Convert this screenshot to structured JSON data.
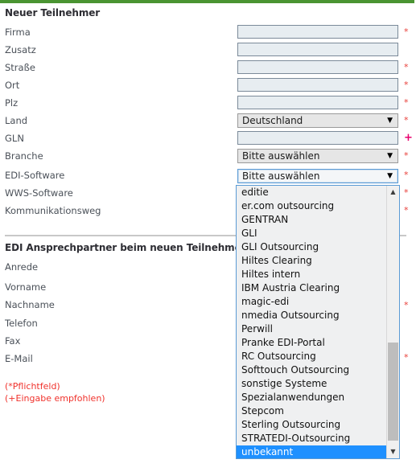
{
  "theme": {
    "accent_green": "#4a9432",
    "required_red": "#e8403a",
    "recommended_pink": "#e8006e",
    "legend_red": "#f0322c",
    "focus_blue": "#5b9bd5",
    "selection_blue": "#1e90ff",
    "input_fill": "#e7edf1",
    "select_fill": "#e6e6e6"
  },
  "sections": {
    "participant": {
      "title": "Neuer Teilnehmer",
      "fields": [
        {
          "label": "Firma",
          "type": "text",
          "value": "",
          "marker": "*"
        },
        {
          "label": "Zusatz",
          "type": "text",
          "value": "",
          "marker": ""
        },
        {
          "label": "Straße",
          "type": "text",
          "value": "",
          "marker": "*"
        },
        {
          "label": "Ort",
          "type": "text",
          "value": "",
          "marker": "*"
        },
        {
          "label": "Plz",
          "type": "text",
          "value": "",
          "marker": "*"
        },
        {
          "label": "Land",
          "type": "select",
          "value": "Deutschland",
          "marker": "*"
        },
        {
          "label": "GLN",
          "type": "text",
          "value": "",
          "marker": "+"
        },
        {
          "label": "Branche",
          "type": "select",
          "value": "Bitte auswählen",
          "marker": "*"
        },
        {
          "label": "EDI-Software",
          "type": "select",
          "value": "Bitte auswählen",
          "marker": "*"
        },
        {
          "label": "WWS-Software",
          "type": "select",
          "value": "",
          "marker": "*"
        },
        {
          "label": "Kommunikationsweg",
          "type": "select",
          "value": "",
          "marker": "*"
        }
      ]
    },
    "contact": {
      "title": "EDI Ansprechpartner beim neuen Teilnehmer",
      "fields": [
        {
          "label": "Anrede",
          "marker": ""
        },
        {
          "label": "Vorname",
          "marker": ""
        },
        {
          "label": "Nachname",
          "marker": "*"
        },
        {
          "label": "Telefon",
          "marker": ""
        },
        {
          "label": "Fax",
          "marker": ""
        },
        {
          "label": "E-Mail",
          "marker": "*"
        }
      ]
    }
  },
  "dropdown": {
    "owner_field": "EDI-Software",
    "open": true,
    "selected": "unbekannt",
    "scroll_up_icon": "▲",
    "scroll_down_icon": "▼",
    "options": [
      "editie",
      "er.com outsourcing",
      "GENTRAN",
      "GLI",
      "GLI Outsourcing",
      "Hiltes Clearing",
      "Hiltes intern",
      "IBM Austria Clearing",
      "magic-edi",
      "nmedia Outsourcing",
      "Perwill",
      "Pranke EDI-Portal",
      "RC Outsourcing",
      "Softtouch Outsourcing",
      "sonstige Systeme",
      "Spezialanwendungen",
      "Stepcom",
      "Sterling Outsourcing",
      "STRATEDI-Outsourcing",
      "unbekannt"
    ]
  },
  "select_arrow_icon": "▼",
  "legend": {
    "required": "(*Pflichtfeld)",
    "recommended": "(+Eingabe empfohlen)"
  }
}
